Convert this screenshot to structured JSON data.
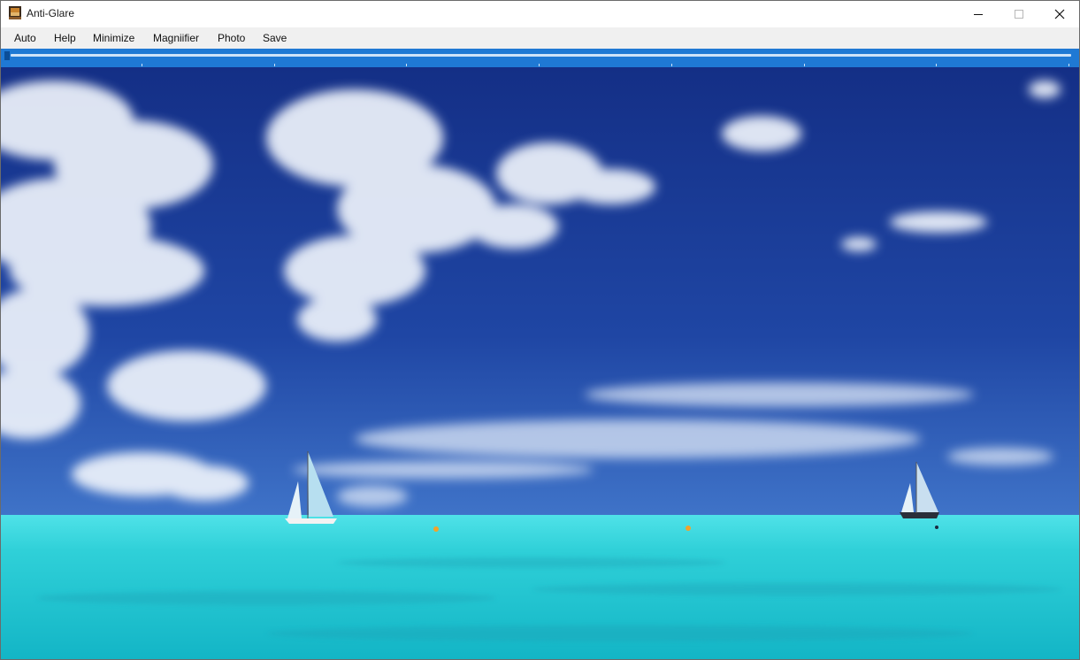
{
  "window": {
    "title": "Anti-Glare",
    "controls": {
      "minimize": "minimize-icon",
      "maximize": "maximize-icon",
      "close": "close-icon"
    }
  },
  "menu": {
    "items": [
      {
        "label": "Auto"
      },
      {
        "label": "Help"
      },
      {
        "label": "Minimize"
      },
      {
        "label": "Magniifier"
      },
      {
        "label": "Photo"
      },
      {
        "label": "Save"
      }
    ]
  },
  "slider": {
    "value": 0,
    "tick_count": 8,
    "band_color": "#1f79d4"
  },
  "photo": {
    "subject": "ocean-with-sailboats",
    "sky_color": "#1d3f9c",
    "sea_color": "#2fd4d8"
  }
}
